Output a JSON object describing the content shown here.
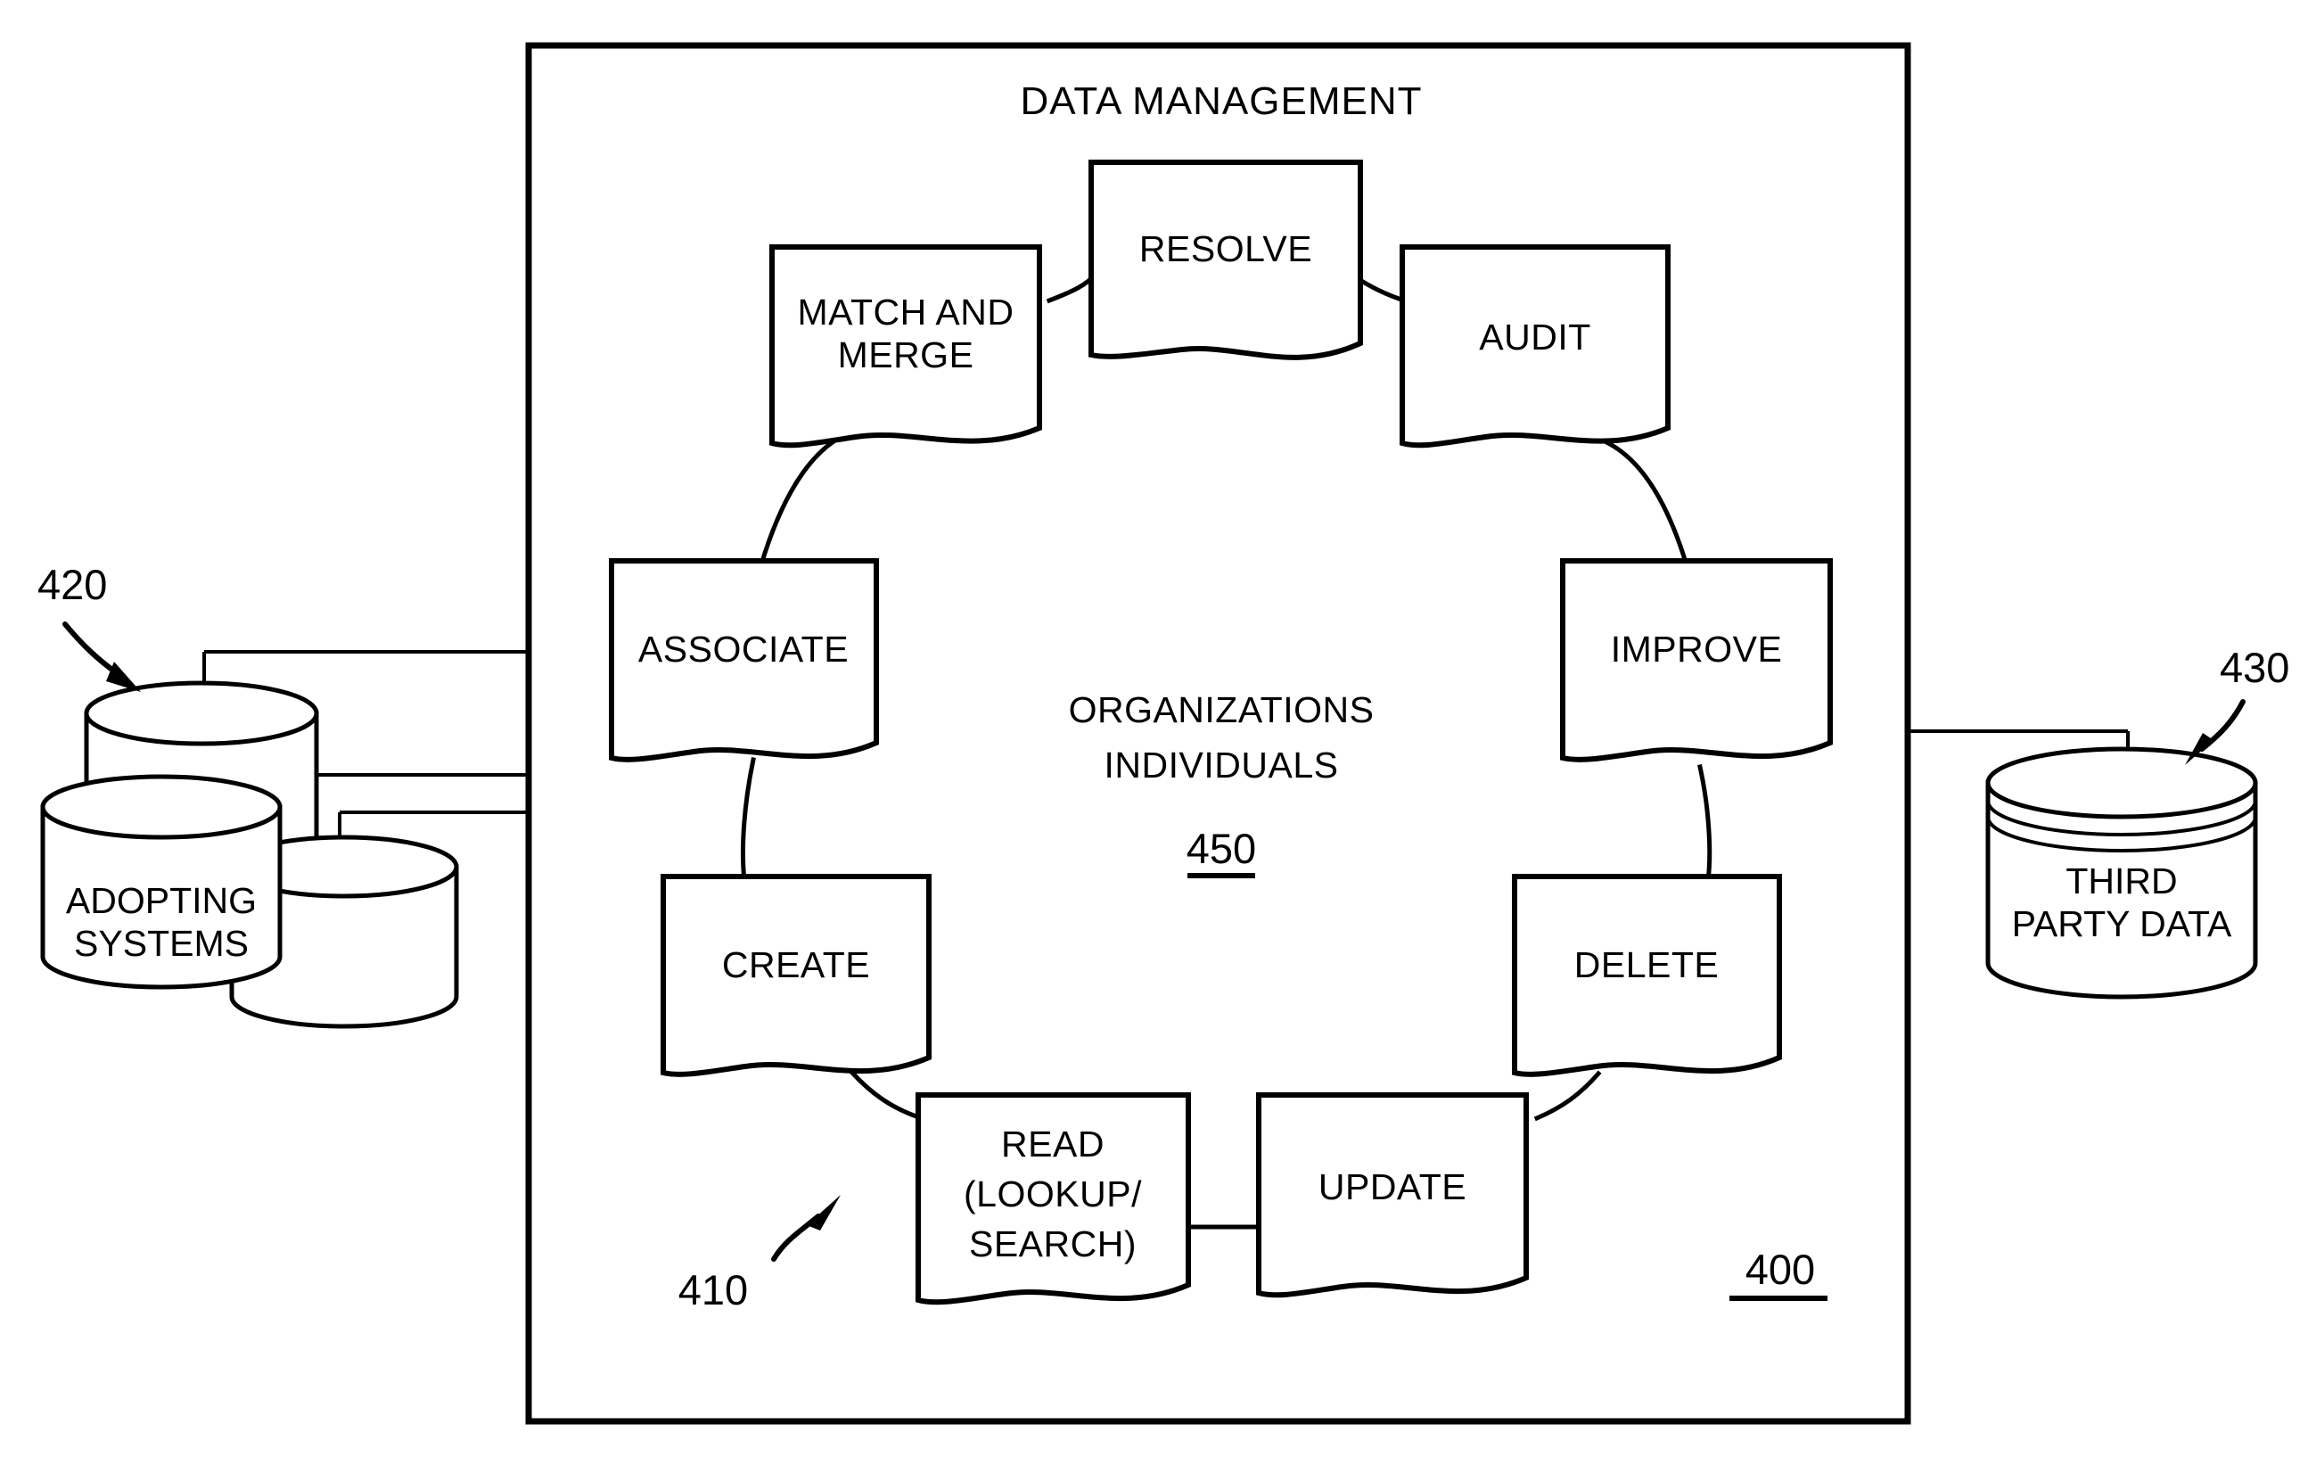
{
  "figure": {
    "title": "DATA MANAGEMENT",
    "frame_ref": "400",
    "cycle_ref": "410",
    "center": {
      "line1": "ORGANIZATIONS",
      "line2": "INDIVIDUALS",
      "ref": "450"
    }
  },
  "nodes": [
    {
      "id": "resolve",
      "label": "RESOLVE"
    },
    {
      "id": "match-and-merge",
      "label_line1": "MATCH AND",
      "label_line2": "MERGE"
    },
    {
      "id": "audit",
      "label": "AUDIT"
    },
    {
      "id": "associate",
      "label": "ASSOCIATE"
    },
    {
      "id": "improve",
      "label": "IMPROVE"
    },
    {
      "id": "create",
      "label": "CREATE"
    },
    {
      "id": "delete",
      "label": "DELETE"
    },
    {
      "id": "read",
      "label_line1": "READ",
      "label_line2": "(LOOKUP/",
      "label_line3": "SEARCH)"
    },
    {
      "id": "update",
      "label": "UPDATE"
    }
  ],
  "external": {
    "adopting_systems": {
      "label_line1": "ADOPTING",
      "label_line2": "SYSTEMS",
      "ref": "420"
    },
    "third_party_data": {
      "label_line1": "THIRD",
      "label_line2": "PARTY DATA",
      "ref": "430"
    }
  },
  "colors": {
    "ink": "#000000",
    "paper": "#ffffff"
  }
}
